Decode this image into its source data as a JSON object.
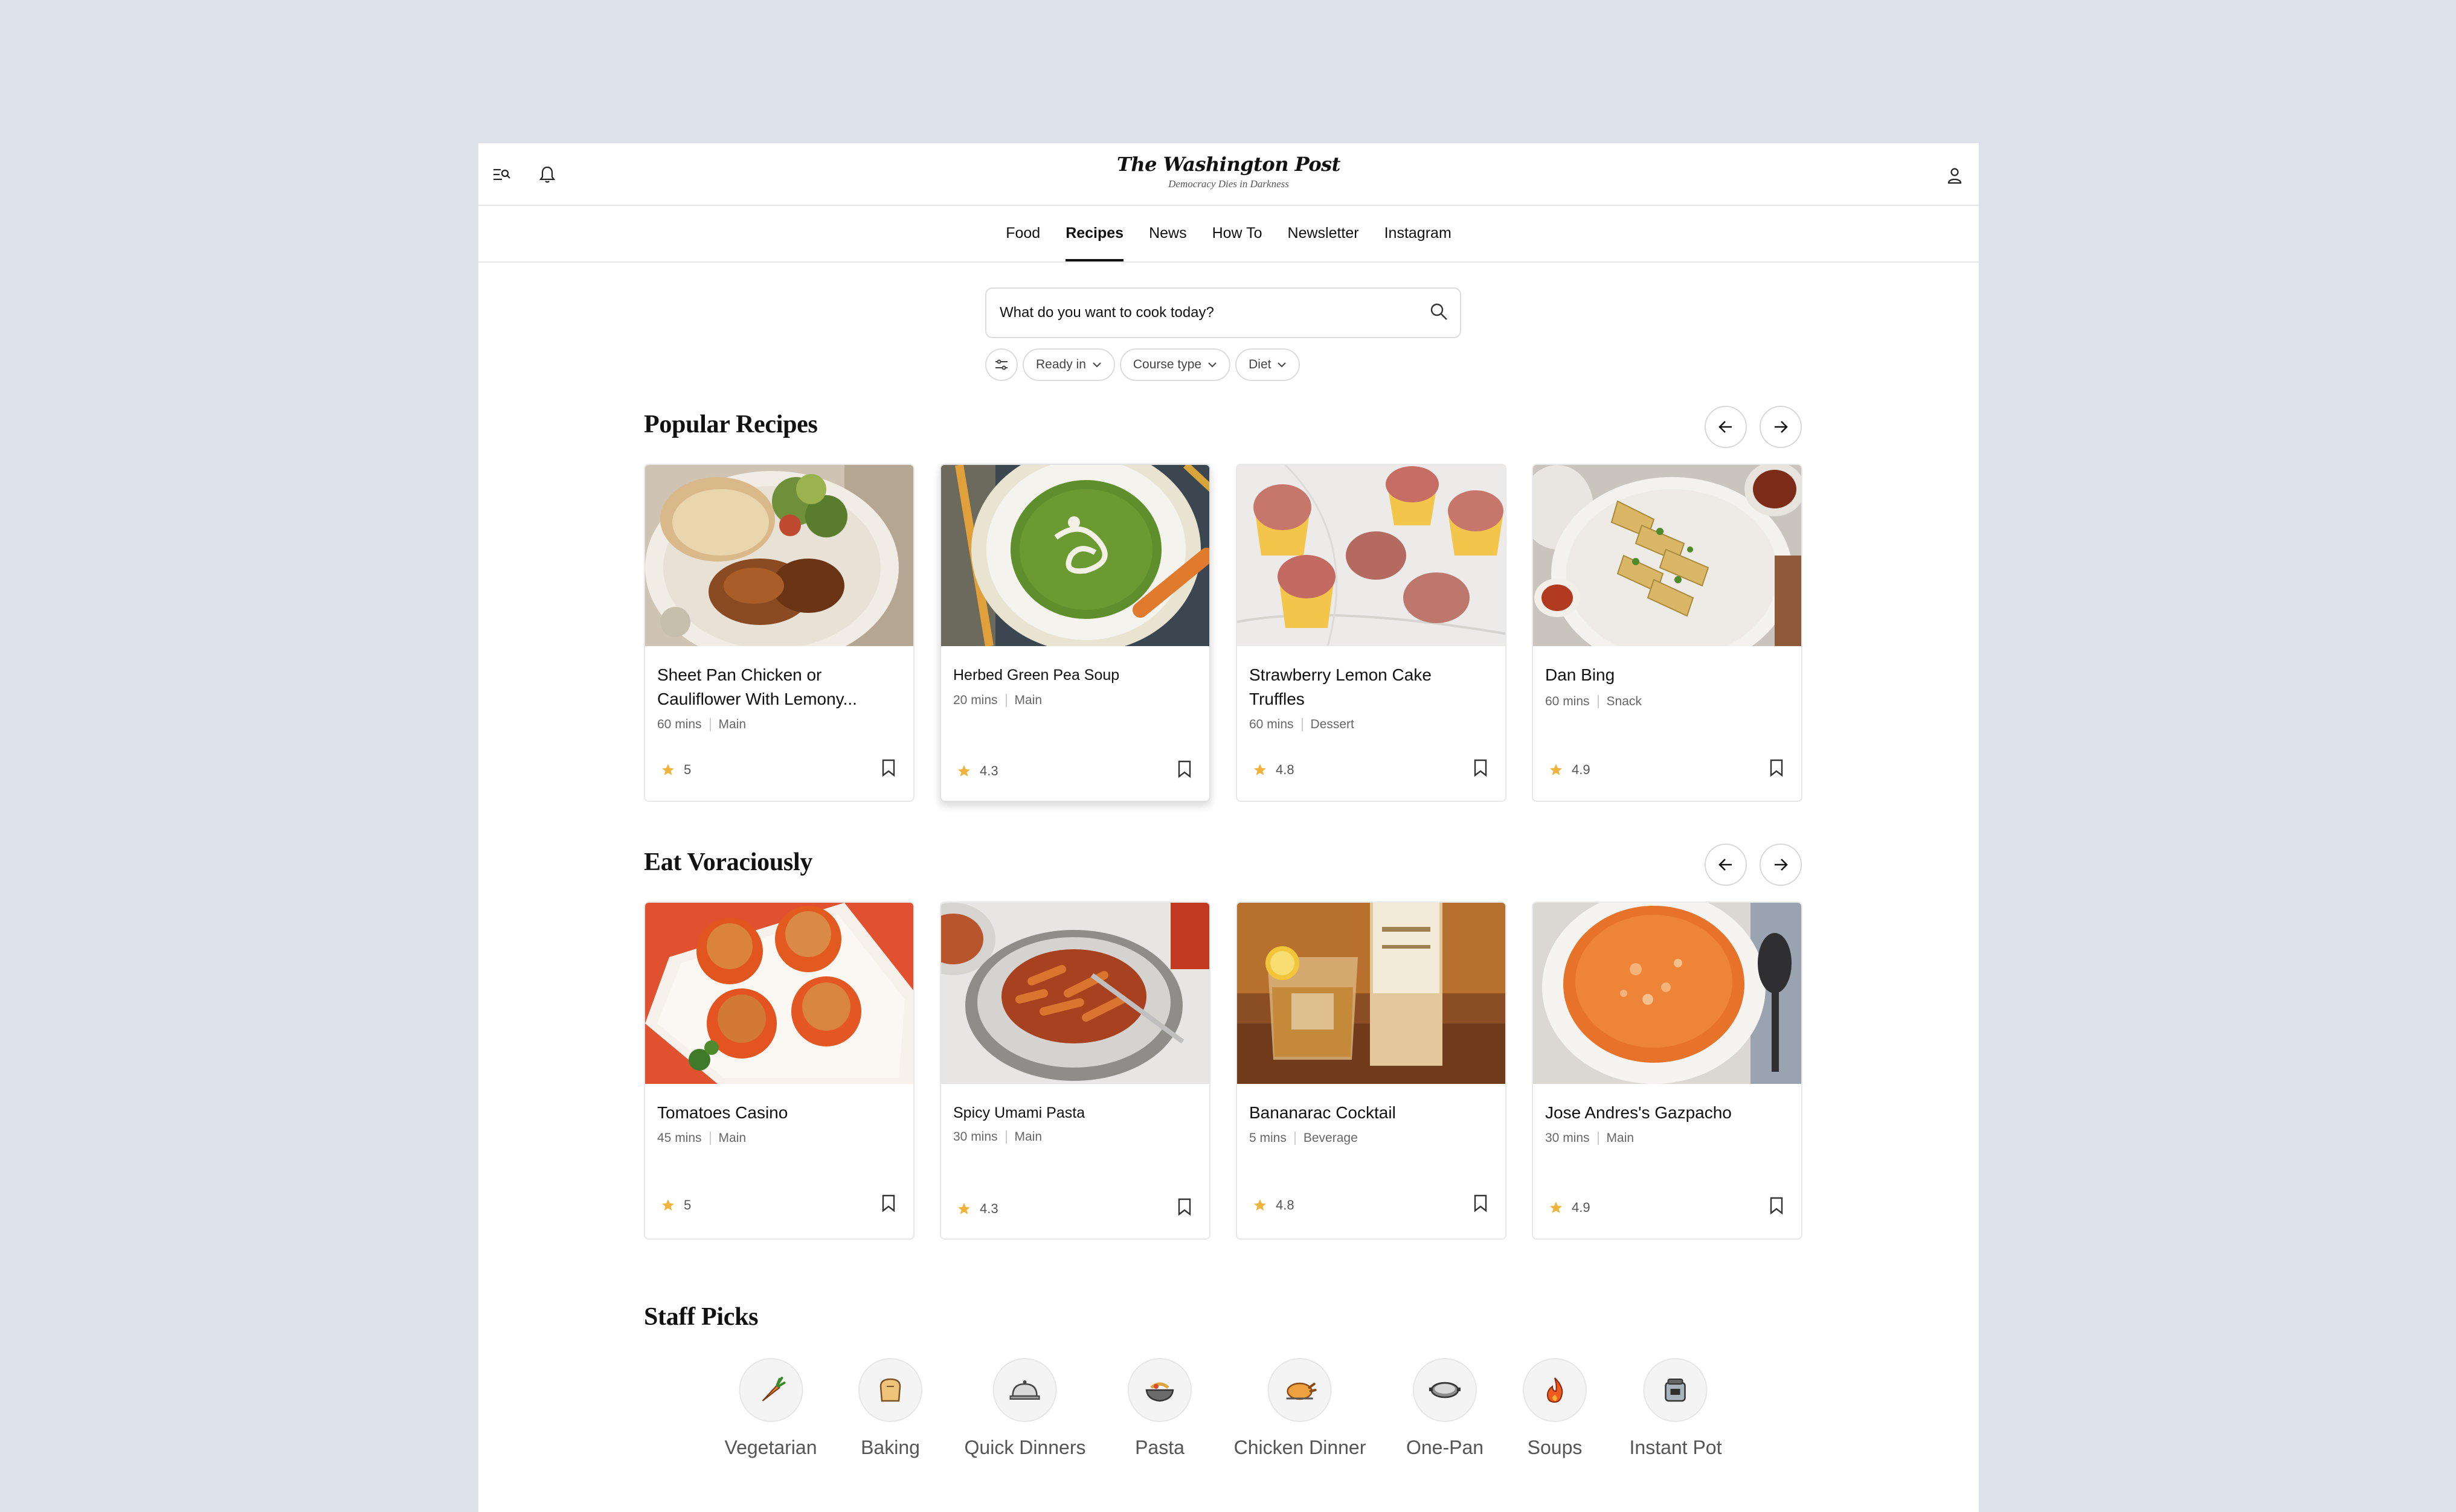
{
  "brand": {
    "name": "The Washington Post",
    "tagline": "Democracy Dies in Darkness"
  },
  "nav": [
    "Food",
    "Recipes",
    "News",
    "How To",
    "Newsletter",
    "Instagram"
  ],
  "nav_active": "Recipes",
  "search": {
    "placeholder": "What do you want to cook today?"
  },
  "filters": [
    "Ready in",
    "Course type",
    "Diet"
  ],
  "sections": {
    "popular": {
      "title": "Popular Recipes",
      "cards": [
        {
          "title": "Sheet Pan Chicken or Cauliflower With Lemony...",
          "time": "60 mins",
          "course": "Main",
          "rating": "5"
        },
        {
          "title": "Herbed Green Pea Soup",
          "time": "20 mins",
          "course": "Main",
          "rating": "4.3"
        },
        {
          "title": "Strawberry Lemon Cake Truffles",
          "time": "60 mins",
          "course": "Dessert",
          "rating": "4.8"
        },
        {
          "title": "Dan Bing",
          "time": "60 mins",
          "course": "Snack",
          "rating": "4.9"
        }
      ]
    },
    "voracious": {
      "title": "Eat Voraciously",
      "cards": [
        {
          "title": "Tomatoes Casino",
          "time": "45 mins",
          "course": "Main",
          "rating": "5"
        },
        {
          "title": "Spicy Umami Pasta",
          "time": "30 mins",
          "course": "Main",
          "rating": "4.3"
        },
        {
          "title": "Bananarac Cocktail",
          "time": "5 mins",
          "course": "Beverage",
          "rating": "4.8"
        },
        {
          "title": "Jose Andres's Gazpacho",
          "time": "30 mins",
          "course": "Main",
          "rating": "4.9"
        }
      ]
    }
  },
  "staff_picks": {
    "title": "Staff Picks",
    "items": [
      {
        "label": "Vegetarian",
        "icon": "carrot-icon"
      },
      {
        "label": "Baking",
        "icon": "bread-icon"
      },
      {
        "label": "Quick Dinners",
        "icon": "cloche-icon"
      },
      {
        "label": "Pasta",
        "icon": "pasta-bowl-icon"
      },
      {
        "label": "Chicken Dinner",
        "icon": "roast-chicken-icon"
      },
      {
        "label": "One-Pan",
        "icon": "pan-icon"
      },
      {
        "label": "Soups",
        "icon": "flame-icon"
      },
      {
        "label": "Instant Pot",
        "icon": "pressure-cooker-icon"
      }
    ]
  },
  "colors": {
    "background": "#dde1e9",
    "star": "#f2b33d",
    "text": "#111111"
  }
}
